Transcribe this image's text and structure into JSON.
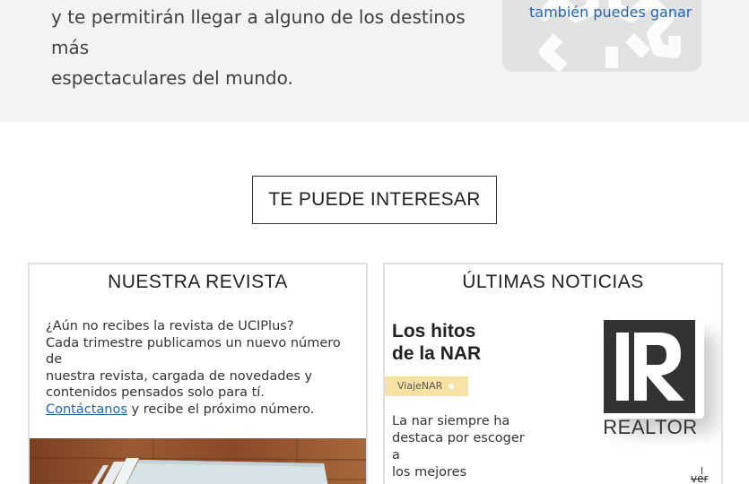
{
  "intro": {
    "line1": "y te permitirán llegar a alguno de los destinos más",
    "line2": "espectaculares del mundo."
  },
  "promo": {
    "link_text": "también puedes ganar",
    "icon": "gear-icon"
  },
  "section_button": {
    "label": "TE PUEDE INTERESAR"
  },
  "magazine": {
    "title": "NUESTRA REVISTA",
    "line1": "¿Aún no recibes la revista de UCIPlus?",
    "line2": "Cada trimestre publicamos un nuevo número de",
    "line3": "nuestra revista, cargada de novedades y",
    "line4": "contenidos pensados solo para tí.",
    "contact_link": "Contáctanos",
    "contact_rest": " y recibe el próximo número."
  },
  "news": {
    "title": "ÚLTIMAS NOTICIAS",
    "headline_line1": "Los hitos",
    "headline_line2": "de la NAR",
    "tag": "ViajeNAR",
    "summary_line1": "La nar siempre ha",
    "summary_line2": "destaca por escoger a",
    "summary_line3": "los mejores",
    "logo_text": "REALTOR",
    "more_link": "ver"
  },
  "colors": {
    "link": "#1f63b3",
    "band": "#f3f3f3",
    "tag": "#f6e3a4",
    "logo": "#333333"
  }
}
